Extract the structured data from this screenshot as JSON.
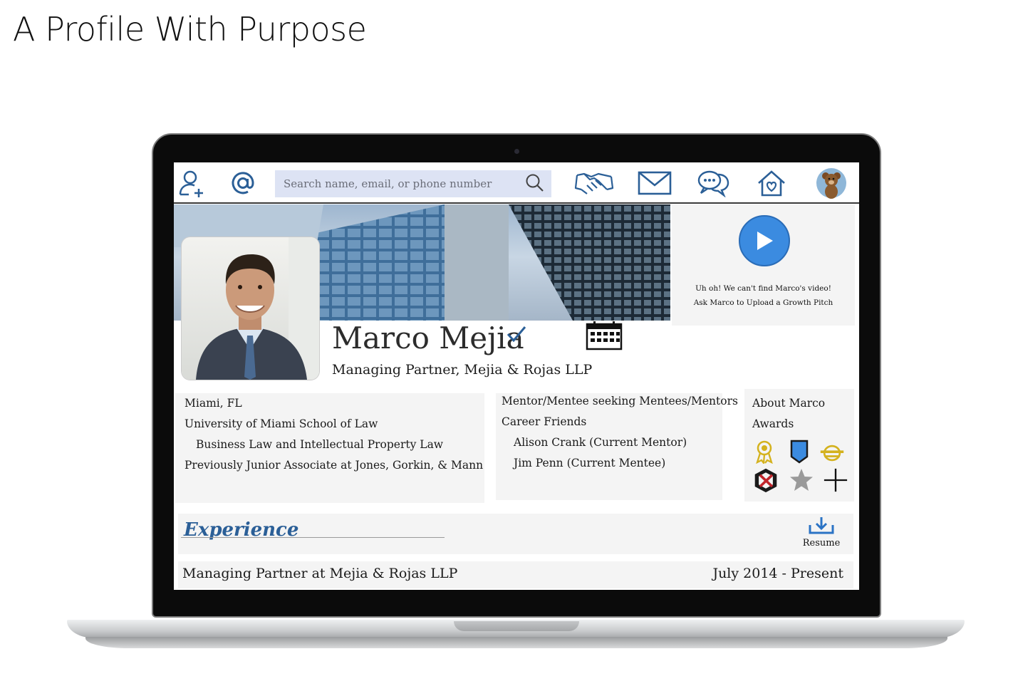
{
  "page": {
    "title": "A Profile With Purpose"
  },
  "nav": {
    "search_placeholder": "Search name, email, or phone number",
    "icons": [
      "add-contact-icon",
      "at-icon",
      "search-icon",
      "handshake-icon",
      "mail-icon",
      "chat-icon",
      "home-heart-icon",
      "avatar-bear-icon"
    ]
  },
  "video": {
    "line1": "Uh oh! We can't find Marco's video!",
    "line2": "Ask Marco to Upload a Growth Pitch"
  },
  "profile": {
    "name": "Marco Mejia",
    "role": "Managing Partner, Mejia & Rojas LLP"
  },
  "info_left": {
    "location": "Miami, FL",
    "school": "University of Miami School of Law",
    "program": "Business Law and Intellectual Property Law",
    "previous": "Previously Junior Associate at Jones, Gorkin, & Mann"
  },
  "info_mid": {
    "mentor_status": "Mentor/Mentee seeking Mentees/Mentors",
    "friends_heading": "Career Friends",
    "friend1": "Alison Crank (Current Mentor)",
    "friend2": "Jim Penn (Current Mentee)"
  },
  "info_right": {
    "about": "About Marco",
    "awards": "Awards"
  },
  "experience": {
    "title": "Experience",
    "resume_label": "Resume",
    "position": "Managing Partner at Mejia & Rojas LLP",
    "dates": "July 2014 - Present"
  },
  "colors": {
    "accent": "#2b5f97",
    "play": "#3b8be0",
    "search_bg": "#dde3f4",
    "panel_bg": "#f4f4f4"
  }
}
